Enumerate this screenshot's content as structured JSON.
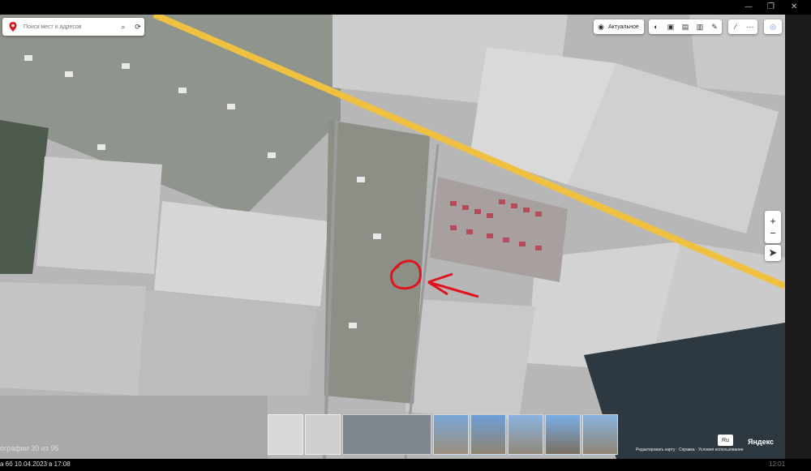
{
  "search": {
    "placeholder": "Поиск мест и адресов"
  },
  "toolbar": {
    "actual_label": "Актуальное"
  },
  "zoom": {
    "in": "+",
    "out": "−"
  },
  "bottom": {
    "counter": "ографии 30 из 95",
    "date": "а 6б  10.04.2023 в 17:08",
    "lang": "Ru",
    "brand": "Яндекс",
    "attribution": "Редактировать карту · Справка · Условия использования",
    "right_clip": "12:01"
  },
  "colors": {
    "road": "#f0c040",
    "marker": "#e0141e",
    "field": "#bdbdbd",
    "black": "#000000"
  },
  "icons": [
    "map-pin-icon",
    "search-icon",
    "route-icon",
    "layers-icon",
    "panorama-icon",
    "parking-icon",
    "transport-icon",
    "ruler-icon",
    "more-icon",
    "profile-icon",
    "location-icon"
  ]
}
